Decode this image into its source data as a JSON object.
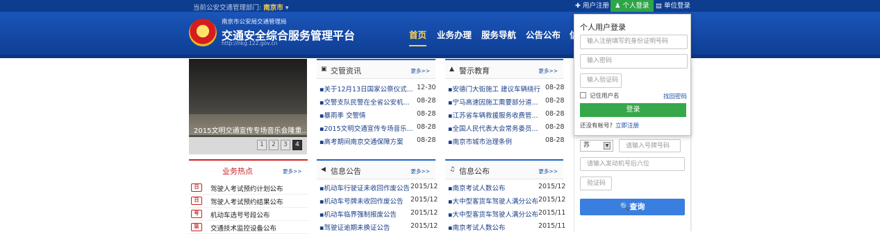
{
  "topbar": {
    "dept_prefix": "当前公安交通管理部门:",
    "dept_name": "南京市",
    "register": "用户注册",
    "personal_login": "个人登录",
    "unit_login": "单位登录"
  },
  "header": {
    "bureau": "南京市公安局交通管理局",
    "title": "交通安全综合服务管理平台",
    "url": "http://nkg.122.gov.cn"
  },
  "nav": [
    "首页",
    "业务办理",
    "服务导航",
    "公告公布",
    "信"
  ],
  "slideshow": {
    "caption": "2015文明交通宣传专场音乐会隆重...",
    "pages": [
      "1",
      "2",
      "3",
      "4"
    ],
    "active_page": "4"
  },
  "panels": {
    "news": {
      "title": "交管资讯",
      "more": "更多>>",
      "items": [
        {
          "t": "▪关于12月13日国家公祭仪式...",
          "d": "12-30"
        },
        {
          "t": "▪交警支队民警在全省公安机...",
          "d": "08-28"
        },
        {
          "t": "▪暴雨季 交警情",
          "d": "08-28"
        },
        {
          "t": "▪2015文明交通宣传专场音乐...",
          "d": "08-28"
        },
        {
          "t": "▪高考期间南京交通保障方案",
          "d": "08-28"
        }
      ]
    },
    "warning": {
      "title": "警示教育",
      "more": "更多>>",
      "items": [
        {
          "t": "▪安德门大街施工 建议车辆绕行",
          "d": "08-28"
        },
        {
          "t": "▪宁马高速因施工需要部分道...",
          "d": "08-28"
        },
        {
          "t": "▪江苏省车辆救援服务收费管...",
          "d": "08-28"
        },
        {
          "t": "▪全国人民代表大会常务委员...",
          "d": "08-28"
        },
        {
          "t": "▪南京市城市治理条例",
          "d": "08-28"
        }
      ]
    },
    "notice": {
      "title": "信息公告",
      "more": "更多>>",
      "items": [
        {
          "t": "▪机动车行驶证未收回作废公告",
          "d": "2015/12"
        },
        {
          "t": "▪机动车号牌未收回作废公告",
          "d": "2015/12"
        },
        {
          "t": "▪机动车临界强制报废公告",
          "d": "2015/12"
        },
        {
          "t": "▪驾驶证逾期未换证公告",
          "d": "2015/12"
        }
      ]
    },
    "publish": {
      "title": "信息公布",
      "more": "更多>>",
      "items": [
        {
          "t": "▪南京考试人数公布",
          "d": "2015/12"
        },
        {
          "t": "▪大中型客货车驾驶人满分公布",
          "d": "2015/12"
        },
        {
          "t": "▪大中型客货车驾驶人满分公布",
          "d": "2015/11"
        },
        {
          "t": "▪南京考试人数公布",
          "d": "2015/11"
        }
      ]
    }
  },
  "hot": {
    "title": "业务热点",
    "more": "更多>>",
    "items": [
      {
        "icon": "日",
        "label": "驾驶人考试预约计划公布"
      },
      {
        "icon": "日",
        "label": "驾驶人考试预约结果公布"
      },
      {
        "icon": "号",
        "label": "机动车选号号段公布"
      },
      {
        "icon": "监",
        "label": "交通技术监控设备公布"
      }
    ]
  },
  "login": {
    "title": "个人用户登录",
    "id_placeholder": "输入注册填写的身份证明号码",
    "pwd_placeholder": "输入密码",
    "captcha_placeholder": "输入验证码",
    "remember": "记住用户名",
    "forgot": "找回密码",
    "submit": "登录",
    "no_account": "还没有帐号?",
    "register_now": "立即注册"
  },
  "query": {
    "province": "苏",
    "plate_placeholder": "请输入号牌号码",
    "engine_placeholder": "请输入发动机号后六位",
    "captcha_placeholder": "验证码",
    "search": "查询"
  },
  "colors": {
    "brand_blue": "#1a55b8",
    "accent_yellow": "#ffd24a",
    "green": "#36a84a",
    "hot_red": "#d32020"
  }
}
